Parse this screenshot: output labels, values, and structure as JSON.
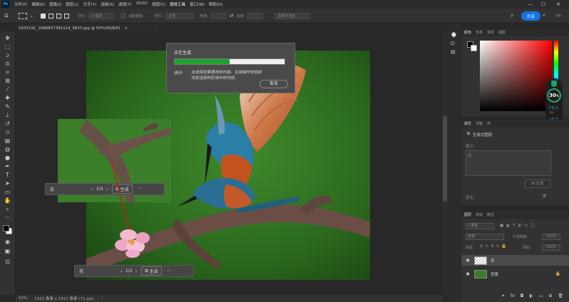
{
  "app": {
    "logo_text": "Ps"
  },
  "menubar": {
    "items": [
      "文件(F)",
      "编辑(E)",
      "图像(I)",
      "图层(L)",
      "文字(Y)",
      "选择(S)",
      "滤镜(T)",
      "3D(D)",
      "视图(V)",
      "增效工具",
      "窗口(W)",
      "帮助(H)"
    ]
  },
  "options": {
    "feather_label": "羽化:",
    "feather_value": "0 像素",
    "antialias": "消除锯齿",
    "style_label": "样式:",
    "style_value": "正常",
    "width_label": "宽度:",
    "height_label": "高度:",
    "select_mask": "选择并遮住...",
    "share": "共享"
  },
  "document": {
    "tab": "1635191_1686837381114_9810.jpg @ 50%(RGB/8)",
    "zoom": "50%",
    "size_info": "1920 像素 x 1552 像素 (72 ppi)"
  },
  "progress_dialog": {
    "title": "正在生成",
    "progress_fraction": 0.5,
    "hint_label": "提示:",
    "hint_text_line1": "仅选择您要更改的内容。生成操作将彻底",
    "hint_text_line2": "改变选择的区域中的内容。",
    "cancel": "取消"
  },
  "popup_small": {
    "prompt": "花",
    "page": "1/3",
    "generate": "生成",
    "more": "···"
  },
  "popup_main": {
    "prompt": "花",
    "page": "1/3",
    "generate": "生成",
    "more": "···"
  },
  "color_panel": {
    "tabs": [
      "颜色",
      "色板",
      "渐变",
      "图案"
    ]
  },
  "perf_widget": {
    "value": "30",
    "unit": "%",
    "up": "5.2",
    "up_unit": "M/s",
    "down": "0.7",
    "down_unit": "K/s"
  },
  "properties_panel": {
    "tabs": [
      "属性",
      "调整",
      "库"
    ],
    "layer_type": "生成式图层",
    "prompt_label": "提示:",
    "prompt_value": "花",
    "generate": "生成",
    "variation_label": "变化"
  },
  "layers_panel": {
    "tabs": [
      "图层",
      "通道",
      "路径"
    ],
    "filter": "类型",
    "mode": "正常",
    "opacity_label": "不透明度:",
    "opacity_value": "100%",
    "lock_label": "锁定:",
    "fill_label": "填充:",
    "fill_value": "100%",
    "layers": [
      {
        "name": "花",
        "thumb": "generative"
      },
      {
        "name": "背景",
        "thumb": "photo"
      }
    ]
  }
}
